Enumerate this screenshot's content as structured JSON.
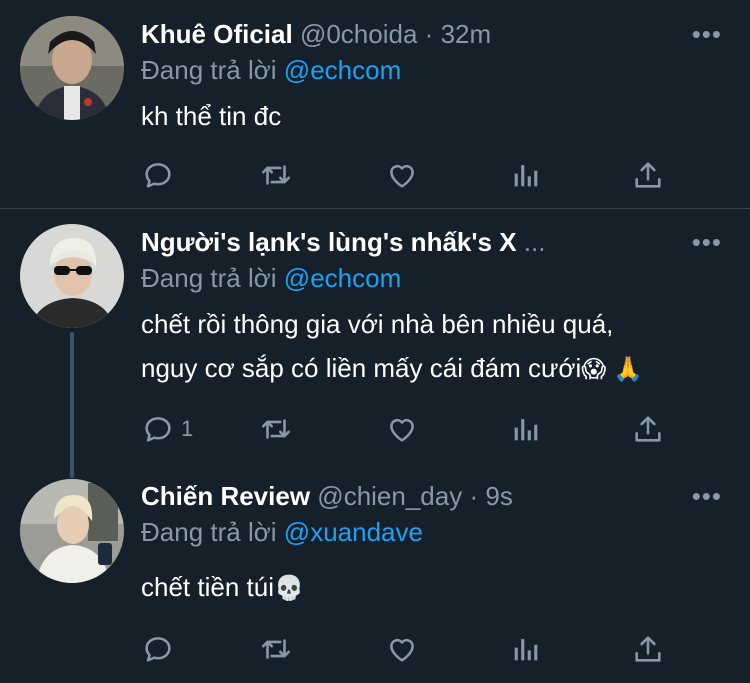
{
  "tweets": [
    {
      "name": "Khuê Oficial",
      "handle": "@0choida",
      "dot": "·",
      "time": "32m",
      "reply_prefix": "Đang trả lời",
      "reply_to": "@echcom",
      "body_lines": [
        "kh thể tin đc"
      ],
      "reply_count": ""
    },
    {
      "name": "Người's lạnk's lùng's nhấk's X",
      "ellipsis": "...",
      "reply_prefix": "Đang trả lời",
      "reply_to": "@echcom",
      "body_lines": [
        "chết rồi thông gia với nhà bên nhiều quá,",
        "nguy cơ sắp có liền mấy cái đám cưới"
      ],
      "emojis": "😱 🙏",
      "reply_count": "1"
    },
    {
      "name": "Chiến Review",
      "handle": "@chien_day",
      "dot": "·",
      "time": "9s",
      "reply_prefix": "Đang trả lời",
      "reply_to": "@xuandave",
      "body_lines": [
        "chết tiền túi"
      ],
      "emojis": "💀",
      "reply_count": ""
    }
  ],
  "more_label": "•••",
  "colors": {
    "background": "#15202b",
    "secondary": "#8899a6",
    "accent": "#1da1f2",
    "divider": "#38444d"
  },
  "icons": [
    "reply-icon",
    "retweet-icon",
    "like-icon",
    "analytics-icon",
    "share-icon",
    "more-icon"
  ]
}
